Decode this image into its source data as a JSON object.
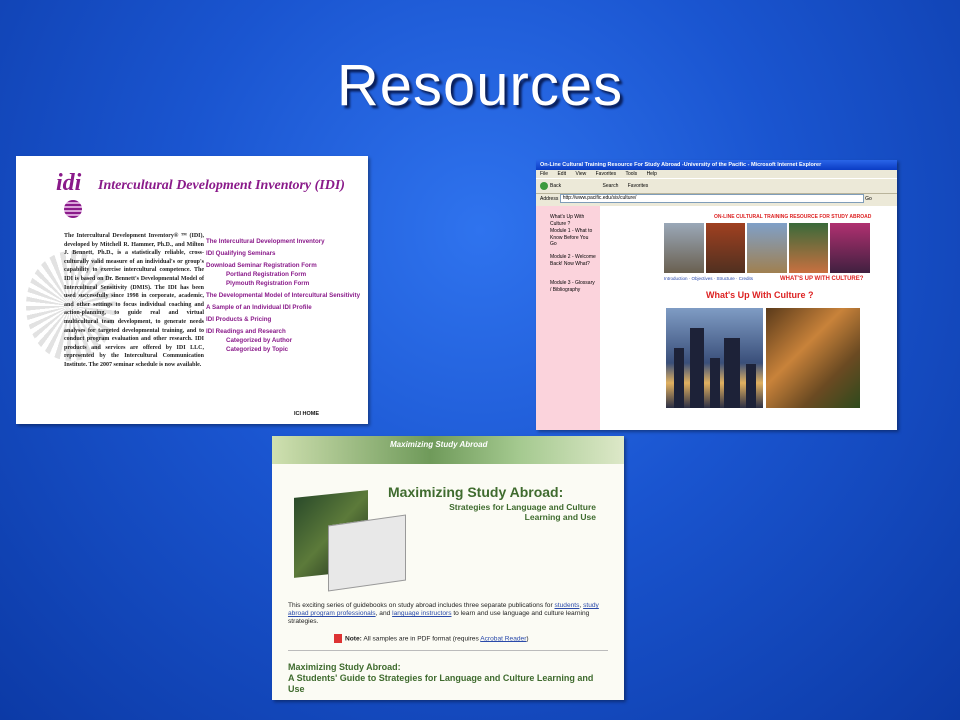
{
  "slide": {
    "title": "Resources"
  },
  "idi": {
    "logo_text": "idi",
    "brand": "Intercultural Development Inventory (IDI)",
    "body": "The Intercultural Development Inventory® ™ (IDI), developed by Mitchell R. Hammer, Ph.D., and Milton J. Bennett, Ph.D., is a statistically reliable, cross-culturally valid measure of an individual's or group's capability to exercise intercultural competence. The IDI is based on Dr. Bennett's Developmental Model of Intercultural Sensitivity (DMIS). The IDI has been used successfully since 1998 in corporate, academic, and other settings to focus individual coaching and action-planning, to guide real and virtual multicultural team development, to generate needs analyses for targeted developmental training, and to conduct program evaluation and other research. IDI products and services are offered by IDI LLC, represented by the Intercultural Communication Institute. The 2007 seminar schedule is now available.",
    "links": [
      "The Intercultural Development Inventory",
      "IDI Qualifying Seminars",
      "Download Seminar Registration Form",
      "Portland Registration Form",
      "Plymouth Registration Form",
      "The Developmental Model of Intercultural Sensitivity",
      "A Sample of an Individual IDI Profile",
      "IDI Products & Pricing",
      "IDI Readings and Research",
      "Categorized by Author",
      "Categorized by Topic"
    ],
    "home": "ICI HOME"
  },
  "ie": {
    "window_title": "On-Line Cultural Training Resource For Study Abroad -University of the Pacific - Microsoft Internet Explorer",
    "menu": [
      "File",
      "Edit",
      "View",
      "Favorites",
      "Tools",
      "Help"
    ],
    "toolbar": [
      "Back",
      "Search",
      "Favorites"
    ],
    "address_label": "Address",
    "address": "http://www.pacific.edu/sis/culture/",
    "go": "Go",
    "sidebar": [
      "What's Up With Culture ?",
      "Module 1 - What to Know Before You Go",
      "Module 2 - Welcome Back! Now What?",
      "Module 3 - Glossary / Bibliography"
    ],
    "header": "ON-LINE CULTURAL TRAINING RESOURCE FOR STUDY ABROAD",
    "navlinks": "Introduction · Objectives · Structure · Credits",
    "whats_up": "WHAT'S UP WITH CULTURE?",
    "heading": "What's Up With Culture ?"
  },
  "msa": {
    "banner": "Maximizing Study Abroad",
    "title": "Maximizing Study Abroad:",
    "subtitle": "Strategies for Language and Culture Learning and Use",
    "para_pre": "This exciting series of guidebooks on study abroad includes three separate publications for ",
    "link_students": "students",
    "link_professionals": "study abroad program professionals",
    "para_mid": ", and ",
    "link_instructors": "language instructors",
    "para_post": " to learn and use language and culture learning strategies.",
    "note_label": "Note:",
    "note_text": " All samples are in PDF format (requires ",
    "note_link": "Acrobat Reader",
    "note_end": ")",
    "guide_title": "Maximizing Study Abroad:",
    "guide_sub": "A Students' Guide to Strategies for Language and Culture Learning and Use"
  }
}
